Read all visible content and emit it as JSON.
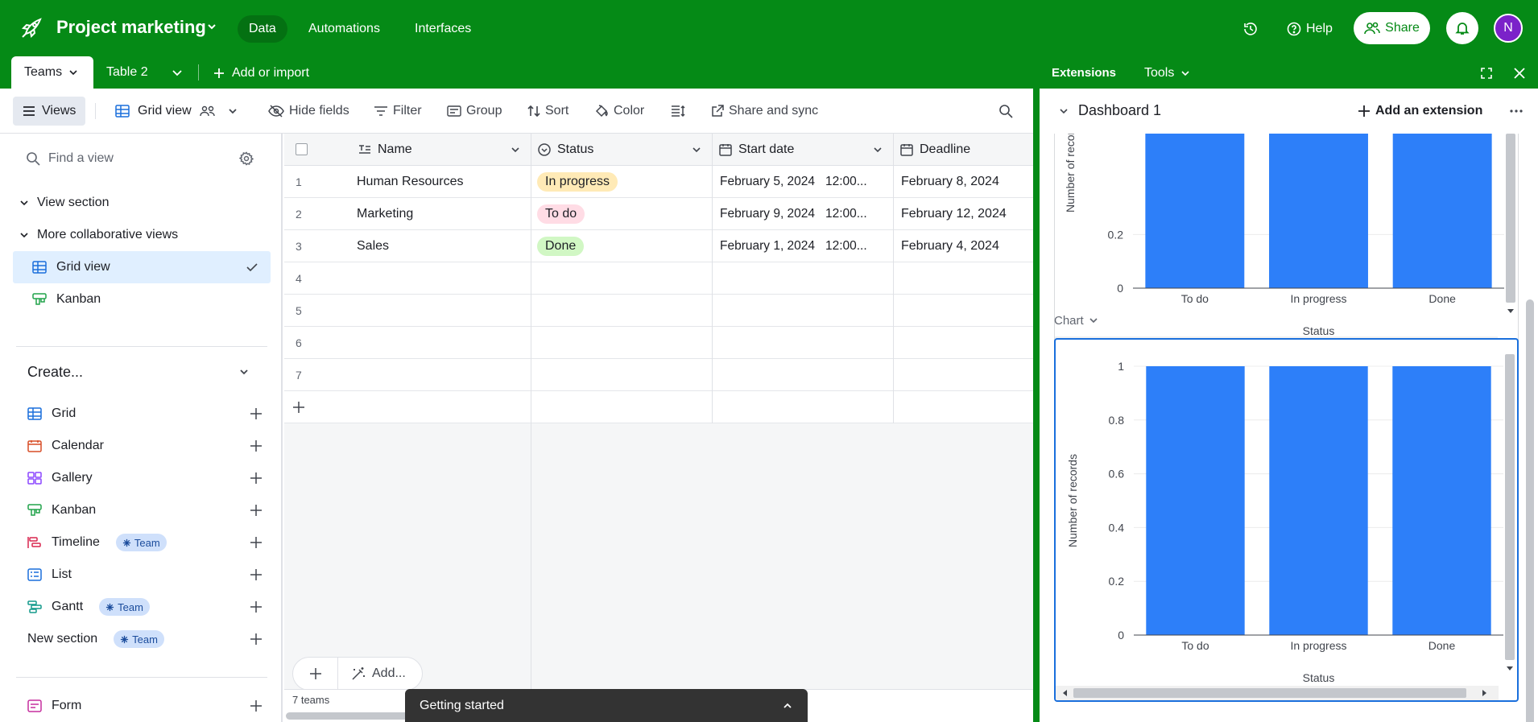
{
  "topbar": {
    "base_name": "Project marketing",
    "nav": [
      "Data",
      "Automations",
      "Interfaces"
    ],
    "help_label": "Help",
    "share_label": "Share",
    "avatar_initial": "N",
    "bg_color": "#058a16"
  },
  "tabs": {
    "items": [
      "Teams",
      "Table 2"
    ],
    "add_label": "Add or import"
  },
  "toolbar": {
    "views_label": "Views",
    "view_name": "Grid view",
    "hide_fields": "Hide fields",
    "filter": "Filter",
    "group": "Group",
    "sort": "Sort",
    "color": "Color",
    "share_sync": "Share and sync"
  },
  "sidebar": {
    "search_placeholder": "Find a view",
    "sections": [
      "View section",
      "More collaborative views"
    ],
    "views": [
      "Grid view",
      "Kanban"
    ],
    "create_label": "Create...",
    "create_items": [
      {
        "label": "Grid",
        "badge": ""
      },
      {
        "label": "Calendar",
        "badge": ""
      },
      {
        "label": "Gallery",
        "badge": ""
      },
      {
        "label": "Kanban",
        "badge": ""
      },
      {
        "label": "Timeline",
        "badge": "Team"
      },
      {
        "label": "List",
        "badge": ""
      },
      {
        "label": "Gantt",
        "badge": "Team"
      },
      {
        "label": "New section",
        "badge": "Team"
      }
    ],
    "form_label": "Form"
  },
  "grid": {
    "columns": [
      "Name",
      "Status",
      "Start date",
      "Deadline"
    ],
    "rows": [
      {
        "num": "1",
        "name": "Human Resources",
        "status": "In progress",
        "status_color": "#ffeab6",
        "start": "February 5, 2024   12:00...",
        "deadline": "February 8, 2024"
      },
      {
        "num": "2",
        "name": "Marketing",
        "status": "To do",
        "status_color": "#ffdce5",
        "start": "February 9, 2024   12:00...",
        "deadline": "February 12, 2024"
      },
      {
        "num": "3",
        "name": "Sales",
        "status": "Done",
        "status_color": "#d1f7c4",
        "start": "February 1, 2024   12:00...",
        "deadline": "February 4, 2024"
      },
      {
        "num": "4",
        "name": "",
        "status": "",
        "status_color": "",
        "start": "",
        "deadline": ""
      },
      {
        "num": "5",
        "name": "",
        "status": "",
        "status_color": "",
        "start": "",
        "deadline": ""
      },
      {
        "num": "6",
        "name": "",
        "status": "",
        "status_color": "",
        "start": "",
        "deadline": ""
      },
      {
        "num": "7",
        "name": "",
        "status": "",
        "status_color": "",
        "start": "",
        "deadline": ""
      }
    ],
    "add_label": "Add...",
    "record_count": "7 teams"
  },
  "getting_started": "Getting started",
  "extensions": {
    "title": "Extensions",
    "tools": "Tools",
    "dashboard": "Dashboard 1",
    "add_extension": "Add an extension",
    "chart_label": "Chart"
  },
  "chart_data": [
    {
      "type": "bar",
      "categories": [
        "To do",
        "In progress",
        "Done"
      ],
      "values": [
        1,
        1,
        1
      ],
      "xlabel": "Status",
      "ylabel": "Number of records",
      "yticks": [
        "0",
        "0.2"
      ],
      "ylim": [
        0,
        1
      ],
      "bar_color": "#2d7ff9"
    },
    {
      "type": "bar",
      "categories": [
        "To do",
        "In progress",
        "Done"
      ],
      "values": [
        1,
        1,
        1
      ],
      "xlabel": "Status",
      "ylabel": "Number of records",
      "yticks": [
        "0",
        "0.2",
        "0.4",
        "0.6",
        "0.8",
        "1"
      ],
      "ylim": [
        0,
        1
      ],
      "bar_color": "#2d7ff9"
    }
  ]
}
